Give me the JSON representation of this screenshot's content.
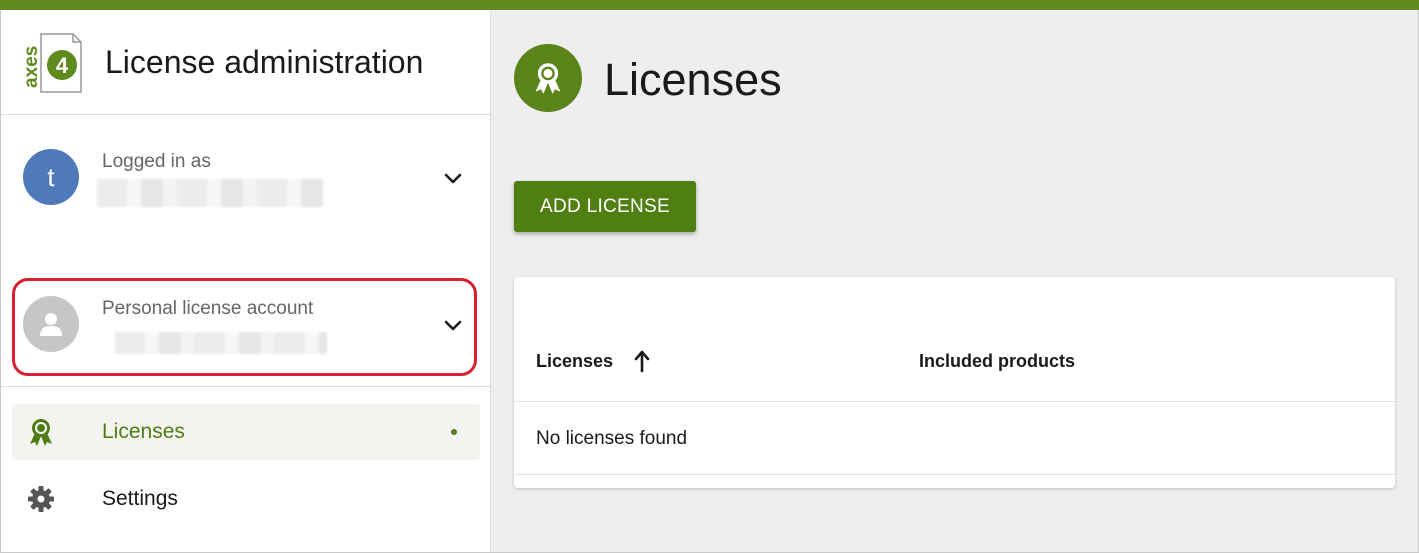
{
  "app": {
    "title": "License administration",
    "logo_text": "axes",
    "logo_digit": "4"
  },
  "colors": {
    "brand_green": "#5f8a1e",
    "button_green": "#4f7f10",
    "highlight_red": "#d8202e",
    "avatar_blue": "#4e79bb"
  },
  "user": {
    "label": "Logged in as",
    "avatar_initial": "t",
    "name_redacted": true
  },
  "account": {
    "label": "Personal license account",
    "name_redacted": true
  },
  "nav": {
    "items": [
      {
        "label": "Licenses",
        "icon": "award-ribbon-icon",
        "active": true
      },
      {
        "label": "Settings",
        "icon": "gear-icon",
        "active": false
      }
    ]
  },
  "page": {
    "title": "Licenses",
    "icon": "award-ribbon-icon",
    "add_button": "ADD LICENSE"
  },
  "table": {
    "columns": [
      "Licenses",
      "Included products"
    ],
    "sort": {
      "column": "Licenses",
      "direction": "ascending"
    },
    "empty_message": "No licenses found"
  }
}
